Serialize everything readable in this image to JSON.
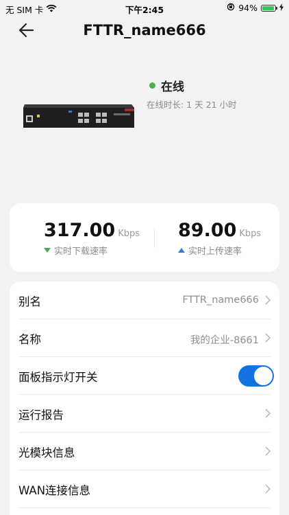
{
  "status_bar": {
    "carrier": "无 SIM 卡",
    "time": "下午2:45",
    "battery_percent": "94%",
    "battery_level": 0.94,
    "accent_green": "#34c759"
  },
  "header": {
    "title": "FTTR_name666",
    "back_icon": "arrow-left-icon"
  },
  "device": {
    "status": "在线",
    "status_color": "#4cb050",
    "uptime": "在线时长: 1 天 21 小时"
  },
  "speeds": {
    "download": {
      "value": "317.00",
      "unit": "Kbps",
      "label": "实时下载速率"
    },
    "upload": {
      "value": "89.00",
      "unit": "Kbps",
      "label": "实时上传速率"
    }
  },
  "settings": {
    "alias": {
      "label": "别名",
      "value": "FTTR_name666"
    },
    "name": {
      "label": "名称",
      "value": "我的企业-8661"
    },
    "panel_light": {
      "label": "面板指示灯开关",
      "enabled": true,
      "toggle_color": "#1274e3"
    },
    "run_report": {
      "label": "运行报告"
    },
    "optical_module": {
      "label": "光模块信息"
    },
    "wan_info": {
      "label": "WAN连接信息"
    }
  }
}
